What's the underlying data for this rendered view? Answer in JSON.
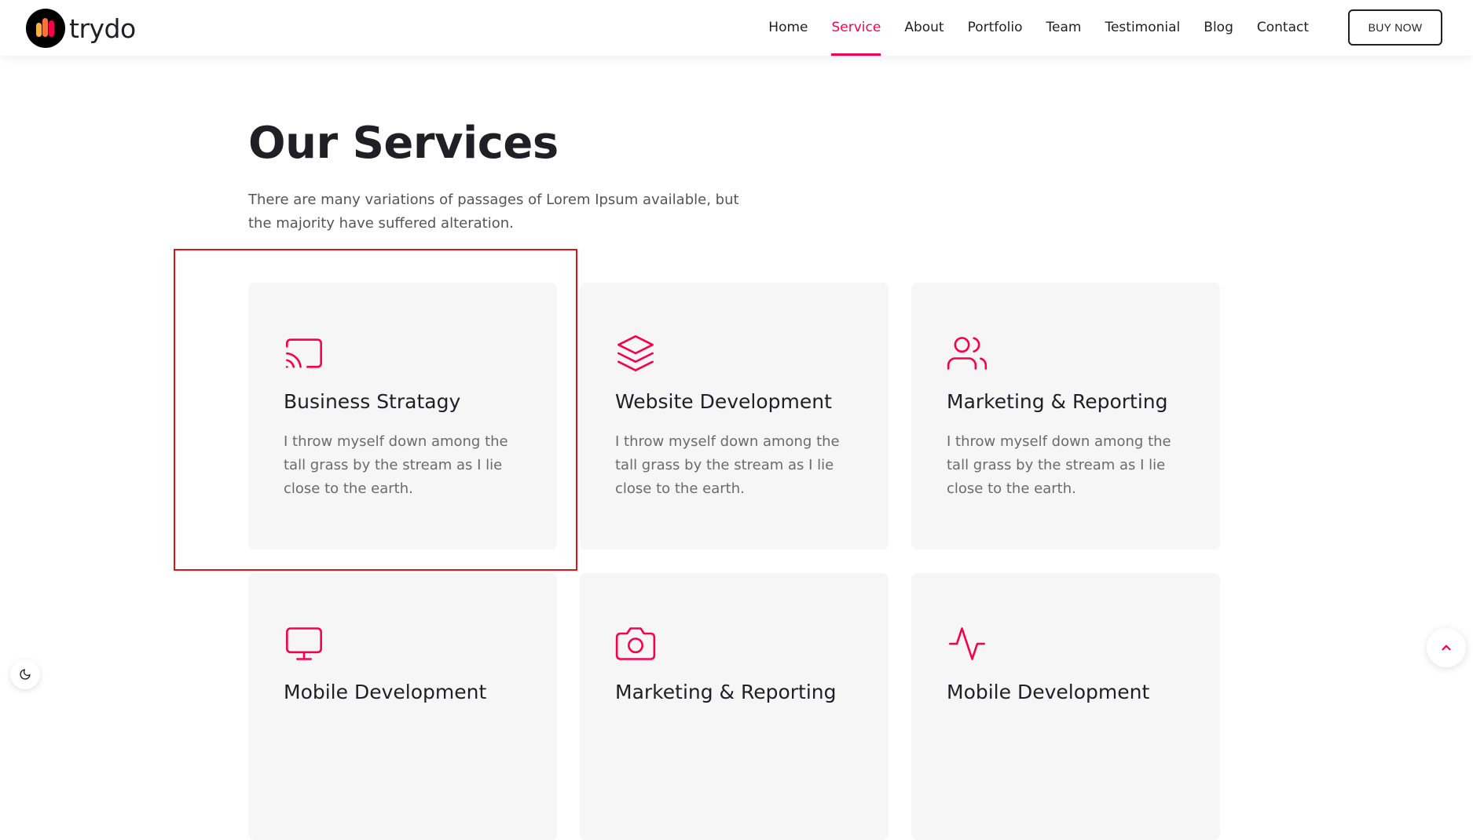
{
  "brand": {
    "name": "trydo",
    "colors": {
      "accent": "#f9004d",
      "logo_bars": [
        "#f9b33b",
        "#f8723b",
        "#f9004d"
      ]
    }
  },
  "nav": {
    "items": [
      {
        "label": "Home",
        "active": false
      },
      {
        "label": "Service",
        "active": true
      },
      {
        "label": "About",
        "active": false
      },
      {
        "label": "Portfolio",
        "active": false
      },
      {
        "label": "Team",
        "active": false
      },
      {
        "label": "Testimonial",
        "active": false
      },
      {
        "label": "Blog",
        "active": false
      },
      {
        "label": "Contact",
        "active": false
      }
    ],
    "buy_label": "BUY NOW"
  },
  "section": {
    "title": "Our Services",
    "subtitle": "There are many variations of passages of Lorem Ipsum available, but the majority have suffered alteration."
  },
  "cards": [
    {
      "icon": "cast-icon",
      "title": "Business Stratagy",
      "text": "I throw myself down among the tall grass by the stream as I lie close to the earth."
    },
    {
      "icon": "layers-icon",
      "title": "Website Development",
      "text": "I throw myself down among the tall grass by the stream as I lie close to the earth."
    },
    {
      "icon": "users-icon",
      "title": "Marketing & Reporting",
      "text": "I throw myself down among the tall grass by the stream as I lie close to the earth."
    },
    {
      "icon": "monitor-icon",
      "title": "Mobile Development",
      "text": ""
    },
    {
      "icon": "camera-icon",
      "title": "Marketing & Reporting",
      "text": ""
    },
    {
      "icon": "activity-icon",
      "title": "Mobile Development",
      "text": ""
    }
  ],
  "highlight": {
    "target": "card-business-stratagy",
    "color": "#e0141e"
  },
  "controls": {
    "dark_mode_icon": "moon-icon",
    "scroll_top_icon": "chevron-up-icon"
  }
}
